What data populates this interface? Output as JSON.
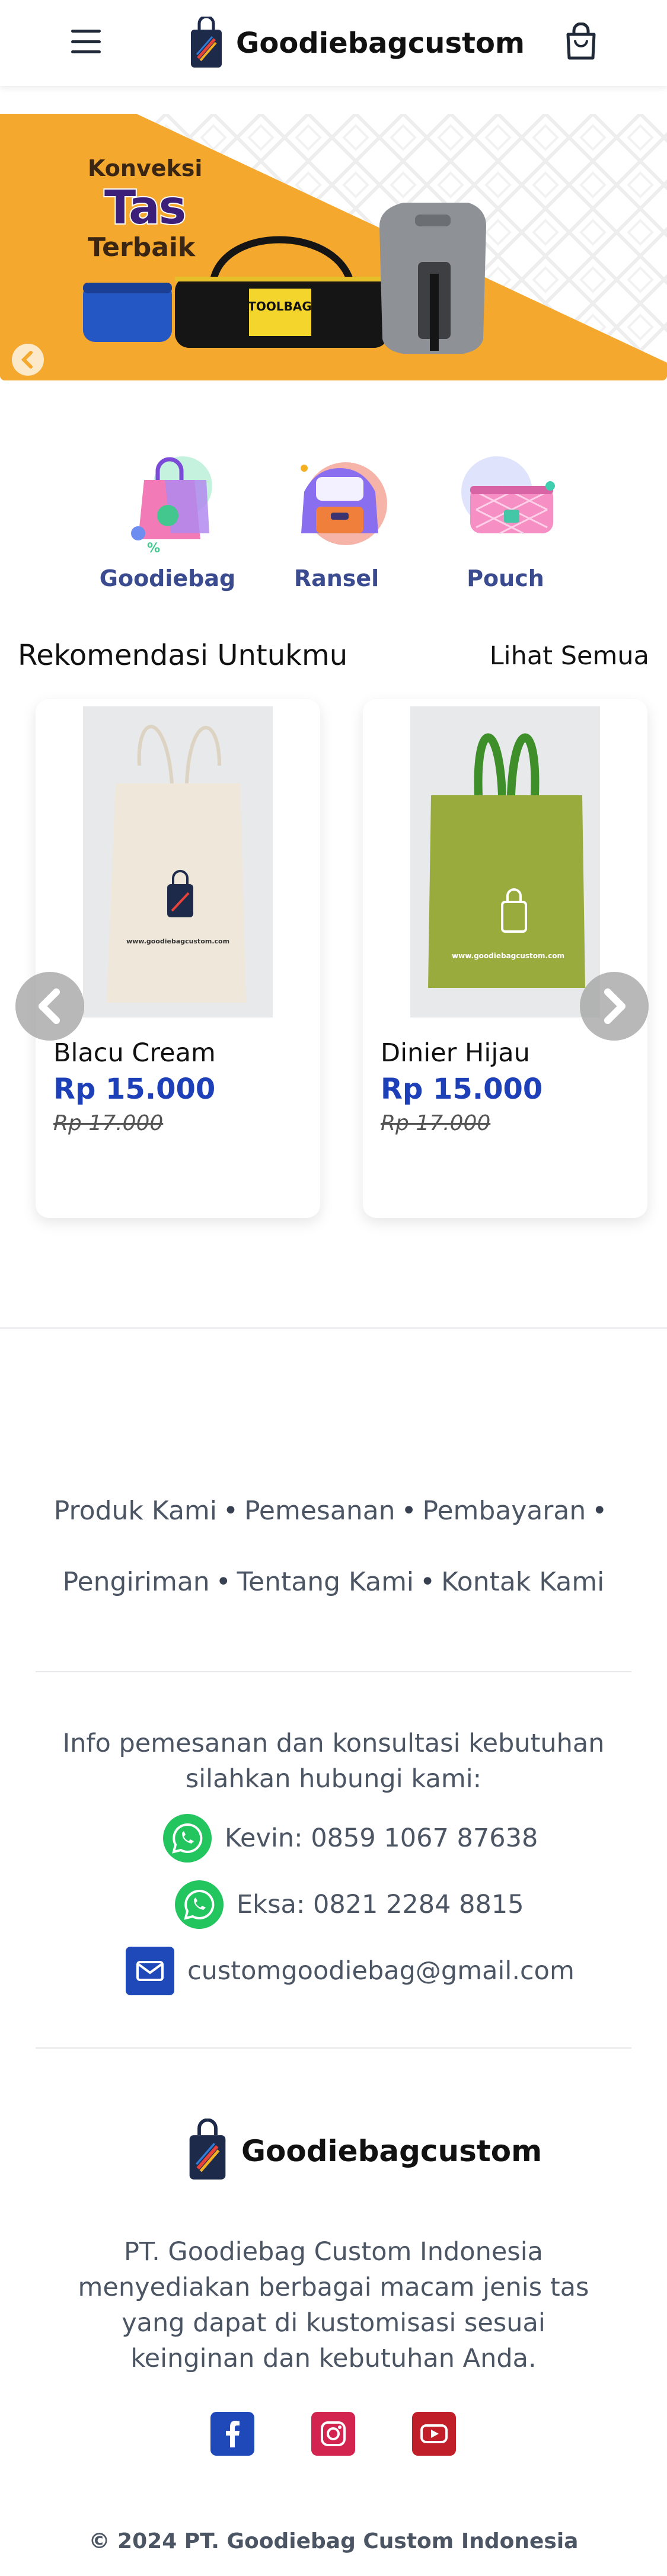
{
  "header": {
    "brand": "Goodiebagcustom"
  },
  "banner": {
    "line1": "Konveksi",
    "line2": "Tas",
    "line3": "Terbaik",
    "bag_label": "TOOLBAG",
    "active_slide": 2,
    "slide_count": 2,
    "colors": {
      "accent": "#f4a82e",
      "active_dot": "#1f5fb0",
      "inactive_dot": "#f7c97a"
    }
  },
  "categories": [
    {
      "label": "Goodiebag",
      "icon": "shopping-bag-icon"
    },
    {
      "label": "Ransel",
      "icon": "backpack-icon"
    },
    {
      "label": "Pouch",
      "icon": "pouch-icon"
    }
  ],
  "recommendations": {
    "title": "Rekomendasi Untukmu",
    "see_all": "Lihat Semua",
    "products": [
      {
        "name": "Blacu Cream",
        "price": "Rp 15.000",
        "old_price": "Rp 17.000",
        "color": "#efe7d9",
        "print": "www.goodiebagcustom.com"
      },
      {
        "name": "Dinier Hijau",
        "price": "Rp 15.000",
        "old_price": "Rp 17.000",
        "color": "#9aab3e",
        "print": "www.goodiebagcustom.com"
      }
    ]
  },
  "footer": {
    "links": [
      "Produk Kami",
      "Pemesanan",
      "Pembayaran",
      "Pengiriman",
      "Tentang Kami",
      "Kontak Kami"
    ],
    "separator": "•",
    "info": "Info pemesanan dan konsultasi kebutuhan silahkan hubungi kami:",
    "contacts": [
      {
        "label": "Kevin: 0859 1067 87638",
        "icon": "whatsapp-icon"
      },
      {
        "label": "Eksa: 0821 2284 8815",
        "icon": "whatsapp-icon"
      },
      {
        "label": "customgoodiebag@gmail.com",
        "icon": "mail-icon"
      }
    ],
    "brand": "Goodiebagcustom",
    "description": "PT. Goodiebag Custom Indonesia menyediakan berbagai macam jenis tas yang dapat di kustomisasi sesuai keinginan dan kebutuhan Anda.",
    "socials": [
      {
        "name": "facebook-icon",
        "color": "#1f48b8"
      },
      {
        "name": "instagram-icon",
        "color": "#d2244f"
      },
      {
        "name": "youtube-icon",
        "color": "#c01f2a"
      }
    ],
    "copyright": "© 2024 PT. Goodiebag Custom Indonesia"
  }
}
